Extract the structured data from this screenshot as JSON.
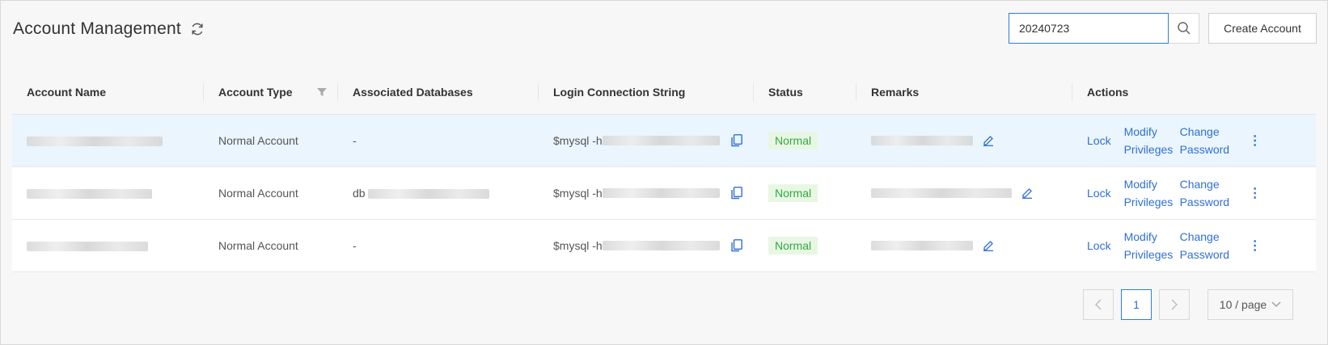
{
  "header": {
    "title": "Account Management"
  },
  "search": {
    "value": "20240723"
  },
  "toolbar": {
    "create_label": "Create Account"
  },
  "table": {
    "columns": [
      "Account Name",
      "Account Type",
      "Associated Databases",
      "Login Connection String",
      "Status",
      "Remarks",
      "Actions"
    ],
    "rows": [
      {
        "type": "Normal Account",
        "db": "-",
        "conn": "$mysql -h",
        "status": "Normal",
        "lock": "Lock",
        "modify": "Modify Privileges",
        "change": "Change Password"
      },
      {
        "type": "Normal Account",
        "db": "db",
        "conn": "$mysql -h",
        "status": "Normal",
        "lock": "Lock",
        "modify": "Modify Privileges",
        "change": "Change Password"
      },
      {
        "type": "Normal Account",
        "db": "-",
        "conn": "$mysql -h",
        "status": "Normal",
        "lock": "Lock",
        "modify": "Modify Privileges",
        "change": "Change Password"
      }
    ]
  },
  "pagination": {
    "current": "1",
    "page_size": "10 / page"
  },
  "colors": {
    "accent": "#2f6fd6",
    "status_green": "#32a844",
    "row_highlight": "#eaf5fd"
  }
}
